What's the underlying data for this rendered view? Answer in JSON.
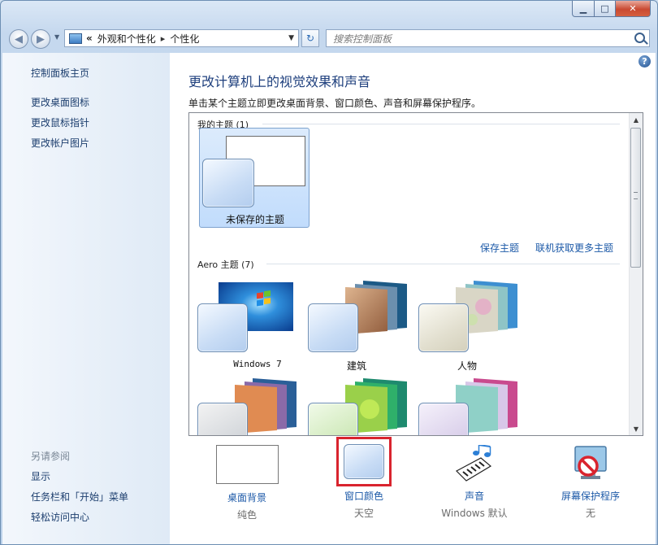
{
  "window": {
    "buttons": {
      "minimize": "▁",
      "maximize": "□",
      "close": "✕"
    }
  },
  "nav": {
    "back": "◀",
    "forward": "▶",
    "chevrons": "«",
    "breadcrumb": [
      "外观和个性化",
      "个性化"
    ],
    "separator": "▸",
    "dropdown": "▼",
    "refresh": "↻",
    "search_placeholder": "搜索控制面板"
  },
  "sidebar": {
    "home": "控制面板主页",
    "links": [
      "更改桌面图标",
      "更改鼠标指针",
      "更改帐户图片"
    ],
    "see_also_title": "另请参阅",
    "see_also": [
      "显示",
      "任务栏和「开始」菜单",
      "轻松访问中心"
    ]
  },
  "main": {
    "help": "?",
    "title": "更改计算机上的视觉效果和声音",
    "description": "单击某个主题立即更改桌面背景、窗口颜色、声音和屏幕保护程序。",
    "my_themes_label": "我的主题 (1)",
    "unsaved_theme": "未保存的主题",
    "save_theme": "保存主题",
    "get_more_themes": "联机获取更多主题",
    "aero_label": "Aero 主题 (7)",
    "aero_themes": [
      "Windows 7",
      "建筑",
      "人物"
    ],
    "scroll_up": "▲",
    "scroll_down": "▼"
  },
  "bottom": {
    "items": [
      {
        "label": "桌面背景",
        "sub": "纯色"
      },
      {
        "label": "窗口颜色",
        "sub": "天空"
      },
      {
        "label": "声音",
        "sub": "Windows 默认"
      },
      {
        "label": "屏幕保护程序",
        "sub": "无"
      }
    ]
  },
  "colors": {
    "highlight_red": "#d9242e",
    "link_blue": "#1d5aa8",
    "title_blue": "#1e3f7d"
  }
}
